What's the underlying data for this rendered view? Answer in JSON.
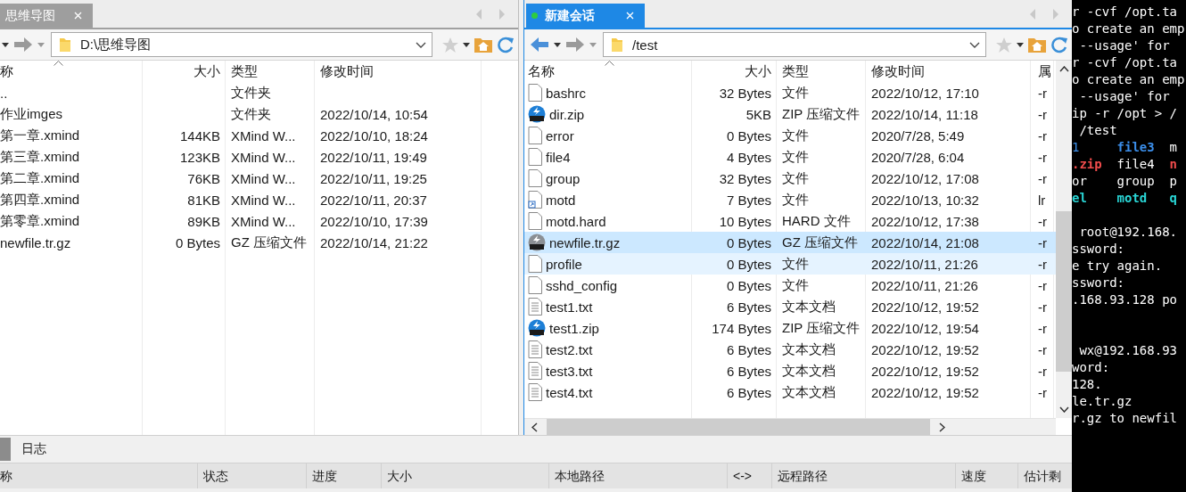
{
  "left_pane": {
    "tab": {
      "label": "思维导图",
      "selected": false
    },
    "path": "D:\\思维导图",
    "columns": [
      "称",
      "大小",
      "类型",
      "修改时间"
    ],
    "rows": [
      {
        "name": "..",
        "size": "",
        "type": "文件夹",
        "modified": ""
      },
      {
        "name": "作业imges",
        "size": "",
        "type": "文件夹",
        "modified": "2022/10/14, 10:54"
      },
      {
        "name": "第一章.xmind",
        "size": "144KB",
        "type": "XMind W...",
        "modified": "2022/10/10, 18:24"
      },
      {
        "name": "第三章.xmind",
        "size": "123KB",
        "type": "XMind W...",
        "modified": "2022/10/11, 19:49"
      },
      {
        "name": "第二章.xmind",
        "size": "76KB",
        "type": "XMind W...",
        "modified": "2022/10/11, 19:25"
      },
      {
        "name": "第四章.xmind",
        "size": "81KB",
        "type": "XMind W...",
        "modified": "2022/10/11, 20:37"
      },
      {
        "name": "第零章.xmind",
        "size": "89KB",
        "type": "XMind W...",
        "modified": "2022/10/10, 17:39"
      },
      {
        "name": "newfile.tr.gz",
        "size": "0 Bytes",
        "type": "GZ 压缩文件",
        "modified": "2022/10/14, 21:22"
      }
    ]
  },
  "right_pane": {
    "tab": {
      "label": "新建会话",
      "selected": true
    },
    "path": "/test",
    "columns": [
      "名称",
      "大小",
      "类型",
      "修改时间",
      "属"
    ],
    "rows": [
      {
        "kind": "file",
        "name": "bashrc",
        "size": "32 Bytes",
        "type": "文件",
        "modified": "2022/10/12, 17:10",
        "attr": "-r",
        "selected": false,
        "hover": false
      },
      {
        "kind": "zip",
        "name": "dir.zip",
        "size": "5KB",
        "type": "ZIP 压缩文件",
        "modified": "2022/10/14, 11:18",
        "attr": "-r",
        "selected": false,
        "hover": false
      },
      {
        "kind": "file",
        "name": "error",
        "size": "0 Bytes",
        "type": "文件",
        "modified": "2020/7/28, 5:49",
        "attr": "-r",
        "selected": false,
        "hover": false
      },
      {
        "kind": "file",
        "name": "file4",
        "size": "4 Bytes",
        "type": "文件",
        "modified": "2020/7/28, 6:04",
        "attr": "-r",
        "selected": false,
        "hover": false
      },
      {
        "kind": "file",
        "name": "group",
        "size": "32 Bytes",
        "type": "文件",
        "modified": "2022/10/12, 17:08",
        "attr": "-r",
        "selected": false,
        "hover": false
      },
      {
        "kind": "link",
        "name": "motd",
        "size": "7 Bytes",
        "type": "文件",
        "modified": "2022/10/13, 10:32",
        "attr": "lr",
        "selected": false,
        "hover": false
      },
      {
        "kind": "file",
        "name": "motd.hard",
        "size": "10 Bytes",
        "type": "HARD 文件",
        "modified": "2022/10/12, 17:38",
        "attr": "-r",
        "selected": false,
        "hover": false
      },
      {
        "kind": "gz",
        "name": "newfile.tr.gz",
        "size": "0 Bytes",
        "type": "GZ 压缩文件",
        "modified": "2022/10/14, 21:08",
        "attr": "-r",
        "selected": true,
        "hover": false
      },
      {
        "kind": "file",
        "name": "profile",
        "size": "0 Bytes",
        "type": "文件",
        "modified": "2022/10/11, 21:26",
        "attr": "-r",
        "selected": false,
        "hover": true
      },
      {
        "kind": "file",
        "name": "sshd_config",
        "size": "0 Bytes",
        "type": "文件",
        "modified": "2022/10/11, 21:26",
        "attr": "-r",
        "selected": false,
        "hover": false
      },
      {
        "kind": "text",
        "name": "test1.txt",
        "size": "6 Bytes",
        "type": "文本文档",
        "modified": "2022/10/12, 19:52",
        "attr": "-r",
        "selected": false,
        "hover": false
      },
      {
        "kind": "zip",
        "name": "test1.zip",
        "size": "174 Bytes",
        "type": "ZIP 压缩文件",
        "modified": "2022/10/12, 19:54",
        "attr": "-r",
        "selected": false,
        "hover": false
      },
      {
        "kind": "text",
        "name": "test2.txt",
        "size": "6 Bytes",
        "type": "文本文档",
        "modified": "2022/10/12, 19:52",
        "attr": "-r",
        "selected": false,
        "hover": false
      },
      {
        "kind": "text",
        "name": "test3.txt",
        "size": "6 Bytes",
        "type": "文本文档",
        "modified": "2022/10/12, 19:52",
        "attr": "-r",
        "selected": false,
        "hover": false
      },
      {
        "kind": "text",
        "name": "test4.txt",
        "size": "6 Bytes",
        "type": "文本文档",
        "modified": "2022/10/12, 19:52",
        "attr": "-r",
        "selected": false,
        "hover": false
      }
    ]
  },
  "bottom": {
    "tabs": [
      {
        "label": "日志",
        "selected": false
      }
    ],
    "columns": [
      "称",
      "状态",
      "进度",
      "大小",
      "本地路径",
      "<->",
      "远程路径",
      "速度",
      "估计剩"
    ]
  },
  "terminal": {
    "blocks": [
      {
        "lines": [
          [
            {
              "text": "r -cvf /opt.ta",
              "color": "#ffffff"
            }
          ],
          [
            {
              "text": "o create an emp",
              "color": "#ffffff"
            }
          ],
          [
            {
              "text": " --usage' for",
              "color": "#ffffff"
            }
          ],
          [
            {
              "text": "r -cvf /opt.ta",
              "color": "#ffffff"
            }
          ],
          [
            {
              "text": "o create an emp",
              "color": "#ffffff"
            }
          ],
          [
            {
              "text": " --usage' for",
              "color": "#ffffff"
            }
          ],
          [
            {
              "text": "ip -r /opt > /",
              "color": "#ffffff"
            }
          ],
          [
            {
              "text": " /test",
              "color": "#ffffff"
            }
          ],
          [
            {
              "text": "1",
              "color": "#3b8eea"
            },
            {
              "text": "file3",
              "color": "#3b8eea",
              "bold": true
            },
            {
              "text": "m",
              "color": "#ffffff"
            }
          ],
          [
            {
              "text": ".zip",
              "color": "#f14c4c",
              "bold": true
            },
            {
              "text": "file4",
              "color": "#ffffff"
            },
            {
              "text": "n",
              "color": "#f14c4c",
              "bold": true
            }
          ],
          [
            {
              "text": "or",
              "color": "#ffffff"
            },
            {
              "text": "group",
              "color": "#ffffff"
            },
            {
              "text": "p",
              "color": "#ffffff"
            }
          ],
          [
            {
              "text": "el",
              "color": "#29d5d5",
              "bold": true
            },
            {
              "text": "motd",
              "color": "#29d5d5",
              "bold": true
            },
            {
              "text": "q",
              "color": "#29d5d5",
              "bold": true
            }
          ]
        ]
      },
      {
        "lines": [
          [
            {
              "text": " root@192.168.",
              "color": "#ffffff"
            }
          ],
          [
            {
              "text": "ssword:",
              "color": "#ffffff"
            }
          ],
          [
            {
              "text": "e try again.",
              "color": "#ffffff"
            }
          ],
          [
            {
              "text": "ssword:",
              "color": "#ffffff"
            }
          ],
          [
            {
              "text": ".168.93.128 po",
              "color": "#ffffff"
            }
          ]
        ]
      },
      {
        "lines": [
          [
            {
              "text": " wx@192.168.93",
              "color": "#ffffff"
            }
          ],
          [
            {
              "text": "word:",
              "color": "#ffffff"
            }
          ],
          [
            {
              "text": "128.",
              "color": "#ffffff"
            }
          ],
          [
            {
              "text": "le.tr.gz",
              "color": "#ffffff"
            }
          ],
          [
            {
              "text": "r.gz to newfil",
              "color": "#ffffff"
            }
          ]
        ]
      }
    ]
  }
}
